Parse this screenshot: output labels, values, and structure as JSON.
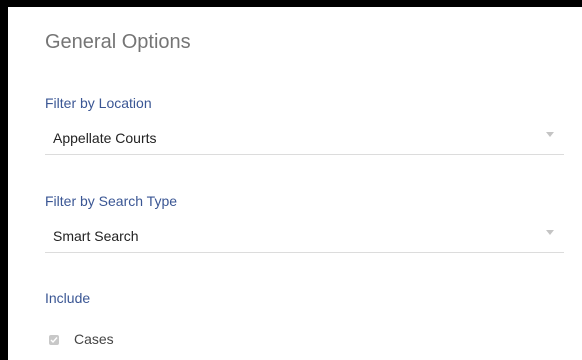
{
  "panel": {
    "title": "General Options"
  },
  "location": {
    "label": "Filter by Location",
    "value": "Appellate Courts"
  },
  "search_type": {
    "label": "Filter by Search Type",
    "value": "Smart Search"
  },
  "include": {
    "label": "Include",
    "options": [
      {
        "label": "Cases",
        "checked": true
      }
    ]
  }
}
